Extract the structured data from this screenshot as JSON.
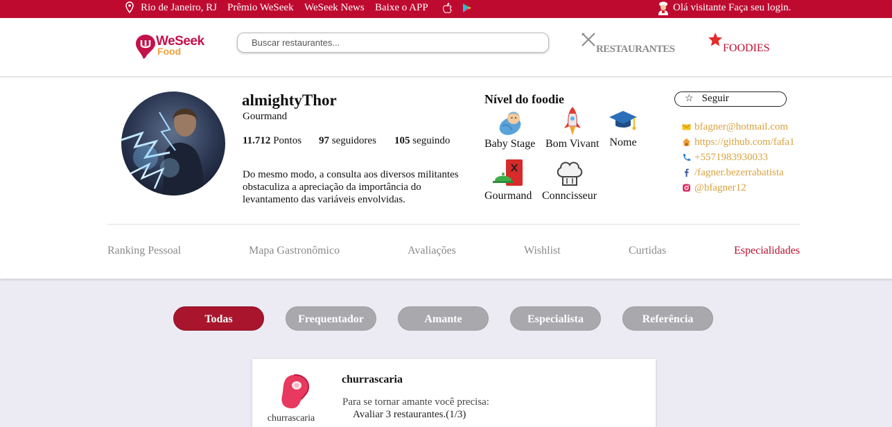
{
  "topbar": {
    "location": "Rio de Janeiro, RJ",
    "links": [
      "Prêmio WeSeek",
      "WeSeek News",
      "Baixe o APP"
    ],
    "login": "Olá visitante Faça seu login."
  },
  "header": {
    "logo_word1": "WeSeek",
    "logo_word2": "Food",
    "search_placeholder": "Buscar restaurantes...",
    "nav_restaurants": "RESTAURANTES",
    "nav_foodies": "FOODIES"
  },
  "profile": {
    "username": "almightyThor",
    "title": "Gourmand",
    "points_value": "11.712",
    "points_label": "Pontos",
    "followers_value": "97",
    "followers_label": "seguidores",
    "following_value": "105",
    "following_label": "seguindo",
    "bio": "Do mesmo modo, a consulta aos diversos militantes obstaculiza a apreciação da importância do levantamento das variáveis envolvidas."
  },
  "levels": {
    "title": "Nível do foodie",
    "items": [
      {
        "label": "Baby Stage",
        "icon": "baby-icon"
      },
      {
        "label": "Bom Vivant",
        "icon": "rocket-icon"
      },
      {
        "label": "Nome",
        "icon": "graduation-cap-icon"
      },
      {
        "label": "Gourmand",
        "icon": "menu-cloche-icon"
      },
      {
        "label": "Conncisseur",
        "icon": "chef-hat-icon"
      }
    ]
  },
  "follow_label": "Seguir",
  "contacts": [
    {
      "icon": "email-icon",
      "text": "bfagner@hotmail.com"
    },
    {
      "icon": "home-icon",
      "text": "https://github.com/fafa1"
    },
    {
      "icon": "phone-icon",
      "text": "+5571983930033"
    },
    {
      "icon": "facebook-icon",
      "text": "/fagner.bezerrabatista"
    },
    {
      "icon": "instagram-icon",
      "text": "@bfagner12"
    }
  ],
  "tabs": [
    "Ranking Pessoal",
    "Mapa Gastronômico",
    "Avaliações",
    "Wishlist",
    "Curtidas",
    "Especialidades"
  ],
  "active_tab": "Especialidades",
  "filters": [
    "Todas",
    "Frequentador",
    "Amante",
    "Especialista",
    "Referência"
  ],
  "active_filter": "Todas",
  "card": {
    "icon_label": "churrascaria",
    "title": "churrascaria",
    "requirement_intro": "Para se tornar amante você precisa:",
    "requirement_item": "Avaliar 3 restaurantes.(1/3)"
  },
  "colors": {
    "brand_red": "#bf0a30",
    "accent_gold": "#d9a23f",
    "pill_active": "#a8152c",
    "pill_inactive": "#a9a9ad"
  }
}
